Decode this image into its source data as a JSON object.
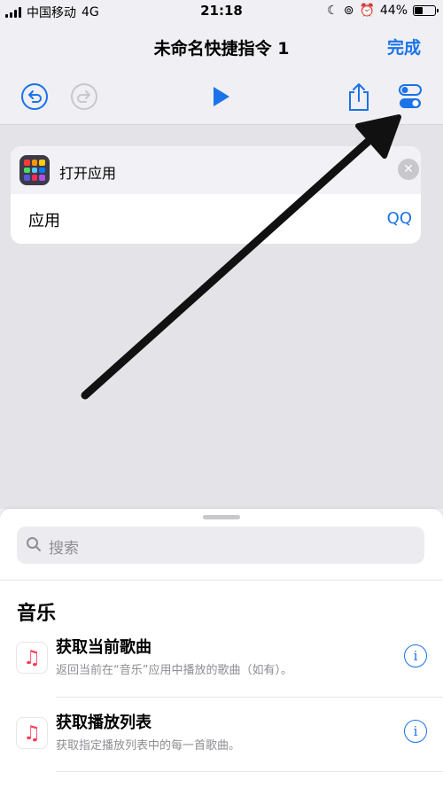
{
  "status": {
    "carrier": "中国移动",
    "network": "4G",
    "time": "21:18",
    "battery": "44%",
    "battery_level": 0.44
  },
  "nav": {
    "title": "未命名快捷指令 1",
    "done": "完成"
  },
  "action_card": {
    "title": "打开应用",
    "param_label": "应用",
    "param_value": "QQ"
  },
  "sheet": {
    "search_placeholder": "搜索",
    "section": "音乐",
    "items": [
      {
        "name": "获取当前歌曲",
        "desc": "返回当前在“音乐”应用中播放的歌曲（如有）。"
      },
      {
        "name": "获取播放列表",
        "desc": "获取指定播放列表中的每一首歌曲。"
      }
    ]
  },
  "colors": {
    "accent": "#1a73e8",
    "arrow": "#111111"
  },
  "icons": [
    "undo-icon",
    "redo-icon",
    "play-icon",
    "share-icon",
    "settings-toggle-icon",
    "app-grid-icon",
    "music-note-icon",
    "info-icon",
    "search-icon"
  ]
}
